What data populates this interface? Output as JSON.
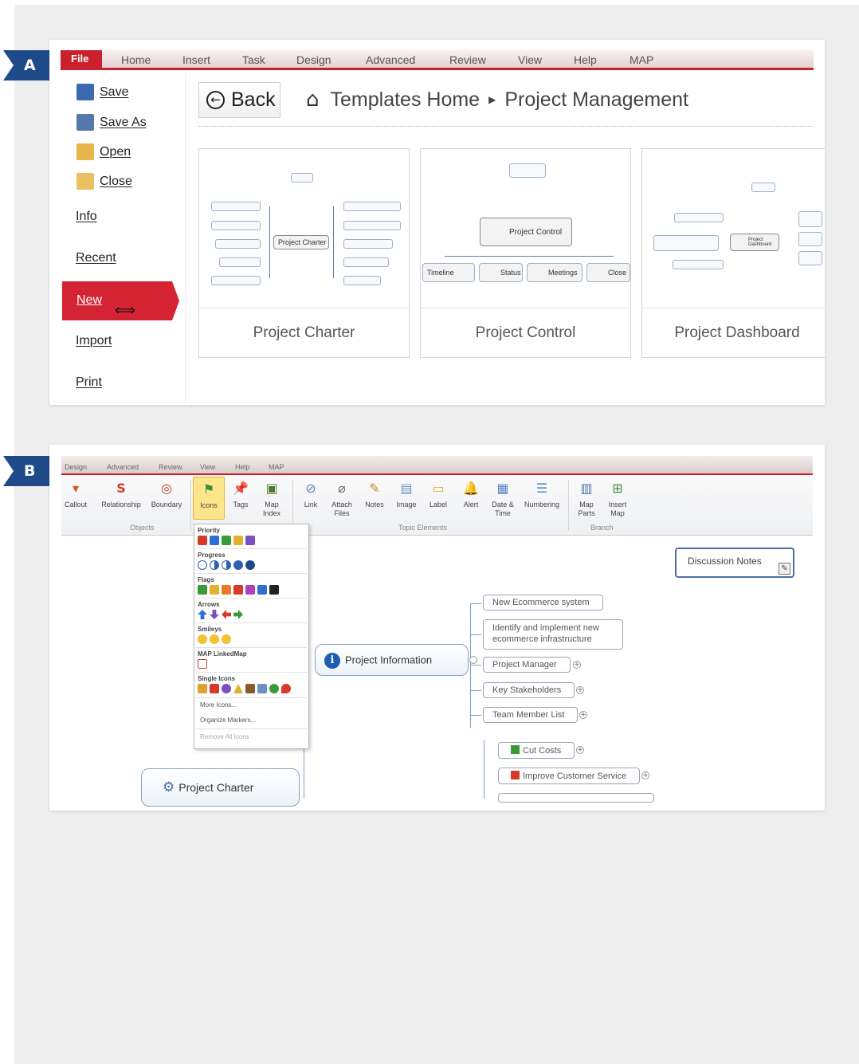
{
  "labels": {
    "a": "A",
    "b": "B"
  },
  "panel_a": {
    "menubar": {
      "file": "File",
      "items": [
        "Home",
        "Insert",
        "Task",
        "Design",
        "Advanced",
        "Review",
        "View",
        "Help",
        "MAP"
      ]
    },
    "backstage": {
      "save": "Save",
      "save_as": "Save As",
      "open": "Open",
      "close": "Close",
      "info": "Info",
      "recent": "Recent",
      "new": "New",
      "import": "Import",
      "print": "Print"
    },
    "back_label": "Back",
    "breadcrumb": {
      "home": "Templates Home",
      "current": "Project Management"
    },
    "templates": [
      {
        "name": "Project Charter"
      },
      {
        "name": "Project Control"
      },
      {
        "name": "Project Dashboard"
      }
    ],
    "thumb_text": {
      "charter_center": "Project Charter",
      "control_center": "Project Control",
      "control_children": [
        "Timeline",
        "Status",
        "Meetings",
        "Close"
      ],
      "dashboard_center": "Project Dashboard"
    }
  },
  "panel_b": {
    "tabs": [
      "Design",
      "Advanced",
      "Review",
      "View",
      "Help",
      "MAP"
    ],
    "ribbon": {
      "buttons": [
        "Callout",
        "Relationship",
        "Boundary",
        "Icons",
        "Tags",
        "Map Index",
        "Link",
        "Attach Files",
        "Notes",
        "Image",
        "Label",
        "Alert",
        "Date & Time",
        "Numbering",
        "Map Parts",
        "Insert Map"
      ],
      "groups": [
        "Objects",
        "Topic Elements",
        "Branch"
      ]
    },
    "icons_menu": {
      "sections": [
        "Priority",
        "Progress",
        "Flags",
        "Arrows",
        "Smileys",
        "MAP LinkedMap",
        "Single Icons"
      ],
      "links": [
        "More Icons...",
        "Organize Markers...",
        "Remove All Icons"
      ]
    },
    "topics": {
      "central": "Project Information",
      "children": [
        "New Ecommerce system",
        "Identify and implement new ecommerce infrastructure",
        "Project Manager",
        "Key Stakeholders",
        "Team Member List"
      ],
      "secondary": [
        "Cut Costs",
        "Improve Customer Service"
      ],
      "discussion": "Discussion Notes",
      "charter": "Project Charter"
    },
    "colors": {
      "accent": "#c9202c",
      "highlight": "#fce58a",
      "info": "#1c5fb0"
    }
  }
}
